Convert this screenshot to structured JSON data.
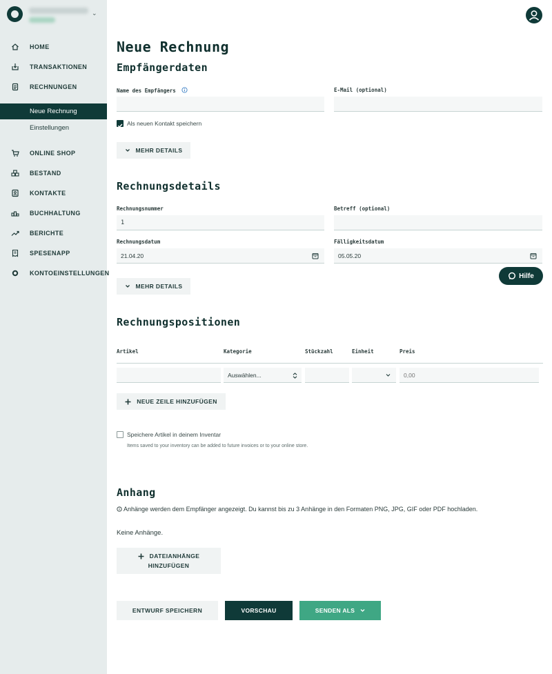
{
  "sidebar": {
    "items": [
      {
        "label": "HOME",
        "icon": "home-icon"
      },
      {
        "label": "TRANSAKTIONEN",
        "icon": "transactions-icon"
      },
      {
        "label": "RECHNUNGEN",
        "icon": "invoice-icon"
      },
      {
        "label": "ONLINE SHOP",
        "icon": "cart-icon"
      },
      {
        "label": "BESTAND",
        "icon": "inventory-icon"
      },
      {
        "label": "KONTAKTE",
        "icon": "contacts-icon"
      },
      {
        "label": "BUCHHALTUNG",
        "icon": "accounting-icon"
      },
      {
        "label": "BERICHTE",
        "icon": "chart-icon"
      },
      {
        "label": "SPESENAPP",
        "icon": "receipt-icon"
      },
      {
        "label": "KONTOEINSTELLUNGEN",
        "icon": "gear-icon"
      }
    ],
    "sub_items": [
      {
        "label": "Neue Rechnung",
        "active": true
      },
      {
        "label": "Einstellungen",
        "active": false
      }
    ]
  },
  "page": {
    "title": "Neue Rechnung"
  },
  "recipient": {
    "heading": "Empfängerdaten",
    "name_label": "Name des Empfängers",
    "name_value": "",
    "email_label": "E-Mail (optional)",
    "email_value": "",
    "save_contact_label": "Als neuen Kontakt speichern",
    "save_contact_checked": true,
    "more_details": "MEHR DETAILS"
  },
  "details": {
    "heading": "Rechnungsdetails",
    "number_label": "Rechnungsnummer",
    "number_value": "1",
    "subject_label": "Betreff (optional)",
    "subject_value": "",
    "date_label": "Rechnungsdatum",
    "date_value": "21.04.20",
    "due_label": "Fälligkeitsdatum",
    "due_value": "05.05.20",
    "more_details": "MEHR DETAILS"
  },
  "help": {
    "label": "Hilfe"
  },
  "positions": {
    "heading": "Rechnungspositionen",
    "columns": [
      "Artikel",
      "Kategorie",
      "Stückzahl",
      "Einheit",
      "Preis"
    ],
    "row": {
      "article": "",
      "category": "Auswählen...",
      "quantity": "",
      "unit": "",
      "price_placeholder": "0,00"
    },
    "add_row": "NEUE ZEILE HINZUFÜGEN",
    "save_inventory_label": "Speichere Artikel in deinem Inventar",
    "save_inventory_checked": false,
    "inventory_hint": "Items saved to your inventory can be added to future invoices or to your online store."
  },
  "attachments": {
    "heading": "Anhang",
    "info": "Anhänge werden dem Empfänger angezeigt.  Du kannst bis zu 3 Anhänge in den Formaten PNG, JPG, GIF oder PDF hochladen.",
    "empty": "Keine Anhänge.",
    "add_line1": "DATEIANHÄNGE",
    "add_line2": "HINZUFÜGEN"
  },
  "actions": {
    "draft": "ENTWURF SPEICHERN",
    "preview": "VORSCHAU",
    "send": "SENDEN ALS"
  },
  "colors": {
    "primary": "#0f3a38",
    "accent": "#3fa784",
    "sidebar_bg": "#e6ecec"
  }
}
